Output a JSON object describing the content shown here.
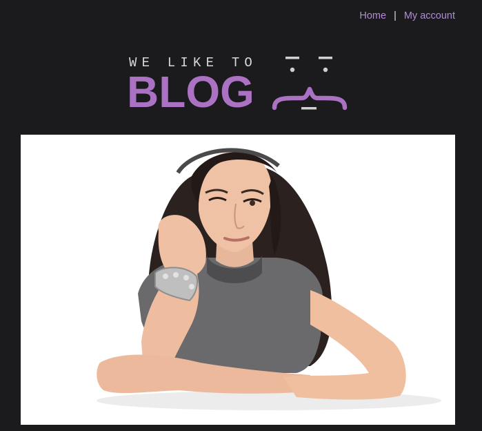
{
  "nav": {
    "home_label": "Home",
    "separator": "|",
    "account_label": "My account"
  },
  "logo": {
    "tagline": "WE LIKE TO",
    "wordmark": "BLOG",
    "accent_color": "#ab72c3",
    "icon": "bored-face-icon"
  },
  "hero": {
    "icon": "bored-girl-photo"
  },
  "colors": {
    "background": "#1b1b1d",
    "link": "#b28cd6",
    "tagline": "#d8d8d8"
  }
}
